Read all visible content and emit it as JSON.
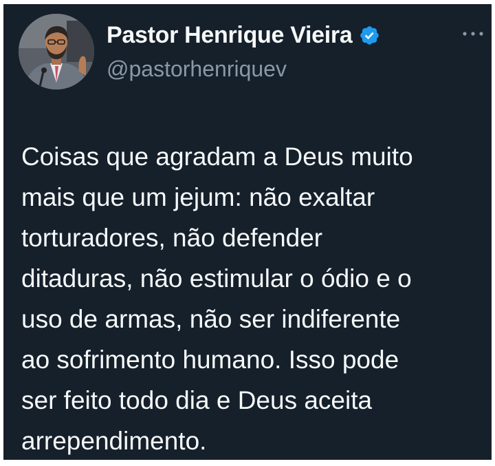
{
  "author": {
    "display_name": "Pastor Henrique Vieira",
    "handle": "@pastorhenriquev",
    "verified": true,
    "avatar_icon": "user-avatar-photo"
  },
  "menu": {
    "icon": "more-horizontal-icon"
  },
  "tweet": {
    "text": "Coisas que agradam a Deus muito\nmais que um jejum: não exaltar\ntorturadores, não defender\nditaduras, não estimular o ódio e o\nuso de armas, não ser indiferente\nao sofrimento humano. Isso pode\nser feito todo dia e Deus aceita\narrependimento."
  },
  "colors": {
    "background": "#15202b",
    "text": "#f7f9f9",
    "secondary_text": "#8b98a5",
    "verified_badge": "#1d9bf0"
  }
}
